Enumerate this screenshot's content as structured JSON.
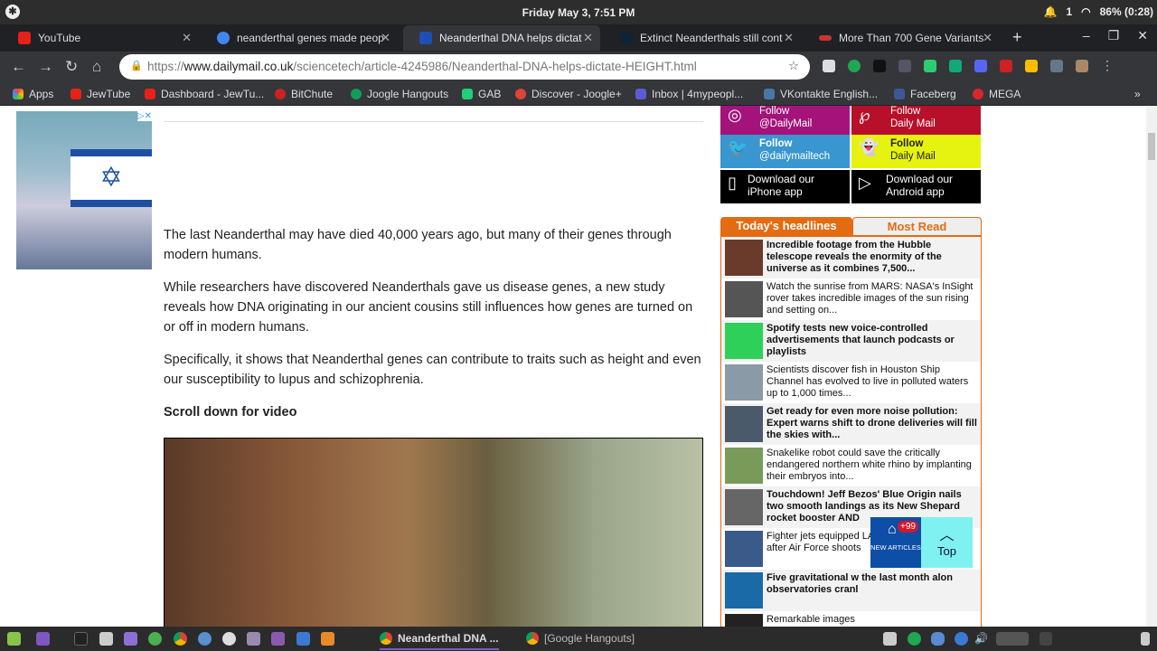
{
  "system": {
    "clock": "Friday May  3, 7:51 PM",
    "notif_count": "1",
    "battery": "86% (0:28)"
  },
  "tabs": [
    {
      "label": "YouTube",
      "color": "#e62117"
    },
    {
      "label": "neanderthal genes made peop",
      "color": "#4285f4"
    },
    {
      "label": "Neanderthal DNA helps dictat",
      "color": "#1f4fb5"
    },
    {
      "label": "Extinct Neanderthals still cont",
      "color": "#123"
    },
    {
      "label": "More Than 700 Gene Variants",
      "color": "#c33"
    }
  ],
  "address": {
    "scheme": "https://",
    "host": "www.dailymail.co.uk",
    "path": "/sciencetech/article-4245986/Neanderthal-DNA-helps-dictate-HEIGHT.html"
  },
  "bookmarks": [
    {
      "label": "Apps",
      "color": "#e44"
    },
    {
      "label": "JewTube",
      "color": "#e62117"
    },
    {
      "label": "Dashboard - JewTu...",
      "color": "#e62117"
    },
    {
      "label": "BitChute",
      "color": "#c22"
    },
    {
      "label": "Joogle Hangouts",
      "color": "#0f9d58"
    },
    {
      "label": "GAB",
      "color": "#21cf7a"
    },
    {
      "label": "Discover - Joogle+",
      "color": "#db4437"
    },
    {
      "label": "Inbox | 4mypeopl...",
      "color": "#5b5bd6"
    },
    {
      "label": "VKontakte English...",
      "color": "#4a76a8"
    },
    {
      "label": "Faceberg",
      "color": "#3b5998"
    },
    {
      "label": "MEGA",
      "color": "#d9272e"
    }
  ],
  "ad": {
    "flag_symbol": "✡"
  },
  "article": {
    "paragraphs": [
      "The last Neanderthal may have died 40,000 years ago, but many of their genes through modern humans.",
      "While researchers have discovered Neanderthals gave us disease genes, a new study reveals how DNA originating in our ancient cousins still influences how genes are turned on or off in modern humans.",
      "Specifically, it shows that Neanderthal genes can contribute to traits such as height and even our susceptibility to lupus and schizophrenia."
    ],
    "scroll_heading": "Scroll down for video"
  },
  "social": [
    {
      "line1": "Follow",
      "line2": "@DailyMail",
      "color": "#a3137a",
      "icon": "instagram-icon"
    },
    {
      "line1": "Follow",
      "line2": "Daily Mail",
      "color": "#b8102a",
      "icon": "pinterest-icon"
    },
    {
      "line1": "Follow",
      "line2": "@dailymailtech",
      "color": "#3a96cf",
      "icon": "twitter-icon"
    },
    {
      "line1": "Follow",
      "line2": "Daily Mail",
      "color": "#e6f20f",
      "icon": "snapchat-icon"
    },
    {
      "line1": "Download our",
      "line2": "iPhone app",
      "color": "#000",
      "icon": "phone-icon"
    },
    {
      "line1": "Download our",
      "line2": "Android app",
      "color": "#000",
      "icon": "play-icon"
    }
  ],
  "headlines": {
    "tab_active": "Today's headlines",
    "tab_other": "Most Read",
    "items": [
      {
        "text": "Incredible footage from the Hubble telescope reveals the enormity of the universe as it combines 7,500...",
        "bold": true,
        "thumb": "#6a3a2a"
      },
      {
        "text": "Watch the sunrise from MARS: NASA's InSight rover takes incredible images of the sun rising and setting on...",
        "bold": false,
        "thumb": "#555"
      },
      {
        "text": "Spotify tests new voice-controlled advertisements that launch podcasts or playlists",
        "bold": true,
        "thumb": "#2fd05a"
      },
      {
        "text": "Scientists discover fish in Houston Ship Channel has evolved to live in polluted waters up to 1,000 times...",
        "bold": false,
        "thumb": "#8a9aa6"
      },
      {
        "text": "Get ready for even more noise pollution: Expert warns shift to drone deliveries will fill the skies with...",
        "bold": true,
        "thumb": "#4a5a6a"
      },
      {
        "text": "Snakelike robot could save the critically endangered northern white rhino by implanting their embryos into...",
        "bold": false,
        "thumb": "#7a9a5a"
      },
      {
        "text": "Touchdown! Jeff Bezos' Blue Origin nails two smooth landings as its New Shepard rocket booster AND",
        "bold": true,
        "thumb": "#666"
      },
      {
        "text": "Fighter jets equipped LASERS take anothe after Air Force shoots",
        "bold": false,
        "thumb": "#3a5a8a"
      },
      {
        "text": "Five gravitational w the last month alon observatories cranl",
        "bold": true,
        "thumb": "#1a6aa8"
      },
      {
        "text": "Remarkable images",
        "bold": false,
        "thumb": "#222"
      }
    ]
  },
  "float": {
    "badge": "+99",
    "new_articles": "NEW ARTICLES",
    "top": "Top"
  },
  "taskbar": {
    "windows": [
      "Neanderthal DNA ...",
      "[Google Hangouts]"
    ]
  }
}
